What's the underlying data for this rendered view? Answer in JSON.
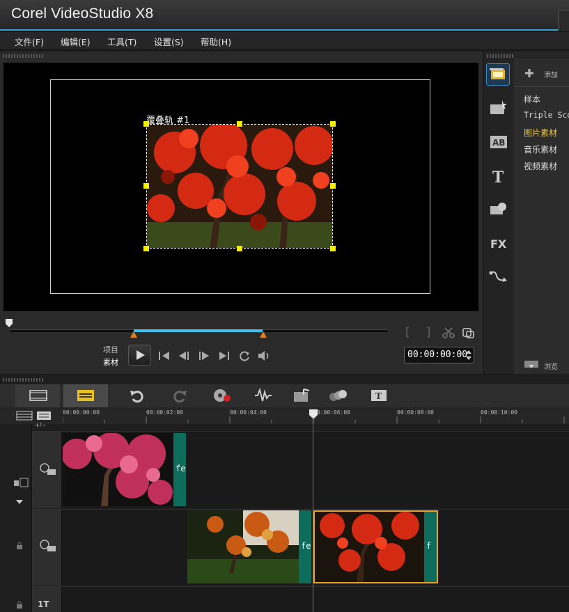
{
  "app": {
    "title": "Corel  VideoStudio X8"
  },
  "menu": [
    {
      "label": "文件(F)"
    },
    {
      "label": "编辑(E)"
    },
    {
      "label": "工具(T)"
    },
    {
      "label": "设置(S)"
    },
    {
      "label": "帮助(H)"
    }
  ],
  "preview": {
    "overlay_label": "覆叠轨 #1",
    "mode_project": "项目",
    "mode_clip": "素材",
    "timecode": "00:00:00:00",
    "bracket_in": "[",
    "bracket_out": "]"
  },
  "library": {
    "add_label": "添加",
    "browse_label": "浏览",
    "items": [
      "样本",
      "Triple Sco",
      "图片素材",
      "音乐素材",
      "视频素材"
    ],
    "selected_index": 2,
    "selected_color": "#f2c83a"
  },
  "timeline": {
    "ruler_labels": [
      "00:00:00:00",
      "00:00:02:00",
      "00:00:04:00",
      "00:00:06:00",
      "00:00:08:00",
      "00:00:10:00"
    ],
    "zoom_label": "+/−",
    "video_track_clip_tail": "fe",
    "overlay_clip1_tail": "fe",
    "overlay_clip2_tail": "f",
    "title_track_label": "1T"
  },
  "colors": {
    "accent_blue": "#3aa0d8",
    "scrub_range": "#3ec2f2",
    "handle_yellow": "#f4ef00",
    "clip_tail_teal": "#0e6c5c",
    "selected_clip_border": "#f0a020"
  }
}
